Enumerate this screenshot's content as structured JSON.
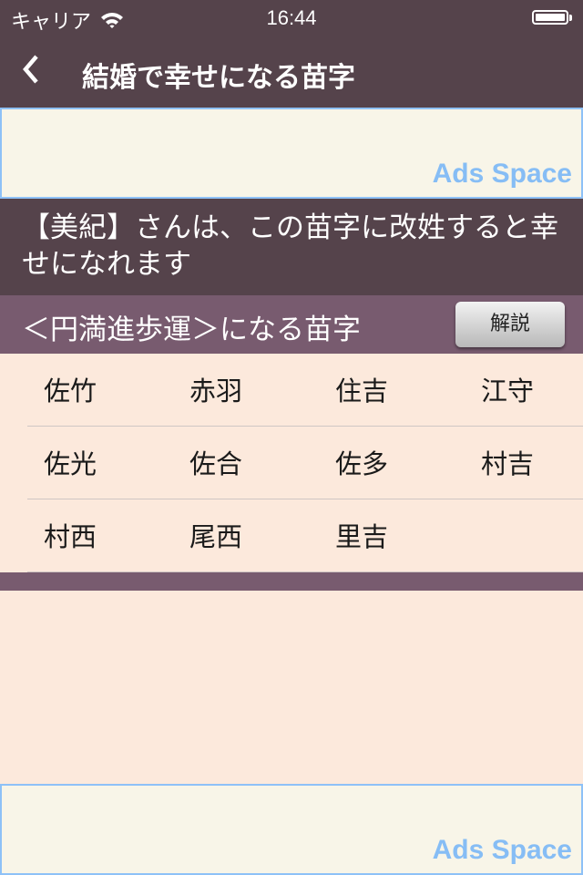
{
  "status_bar": {
    "carrier": "キャリア",
    "time": "16:44",
    "battery_level": 1.0
  },
  "nav": {
    "back_icon": "chevron-left-icon",
    "title": "結婚で幸せになる苗字"
  },
  "ads": {
    "top_label": "Ads Space",
    "bottom_label": "Ads Space"
  },
  "message": {
    "text": "【美紀】さんは、この苗字に改姓すると幸せになれます"
  },
  "section": {
    "title": "＜円満進歩運＞になる苗字",
    "explain_button": "解説"
  },
  "surnames": [
    [
      "佐竹",
      "赤羽",
      "住吉",
      "江守"
    ],
    [
      "佐光",
      "佐合",
      "佐多",
      "村吉"
    ],
    [
      "村西",
      "尾西",
      "里吉",
      ""
    ]
  ],
  "colors": {
    "header_bg": "#55434b",
    "section_bg": "#785b6f",
    "content_bg": "#fce9dc",
    "ad_bg": "#f8f5e8",
    "ad_accent": "#86bdf5"
  }
}
